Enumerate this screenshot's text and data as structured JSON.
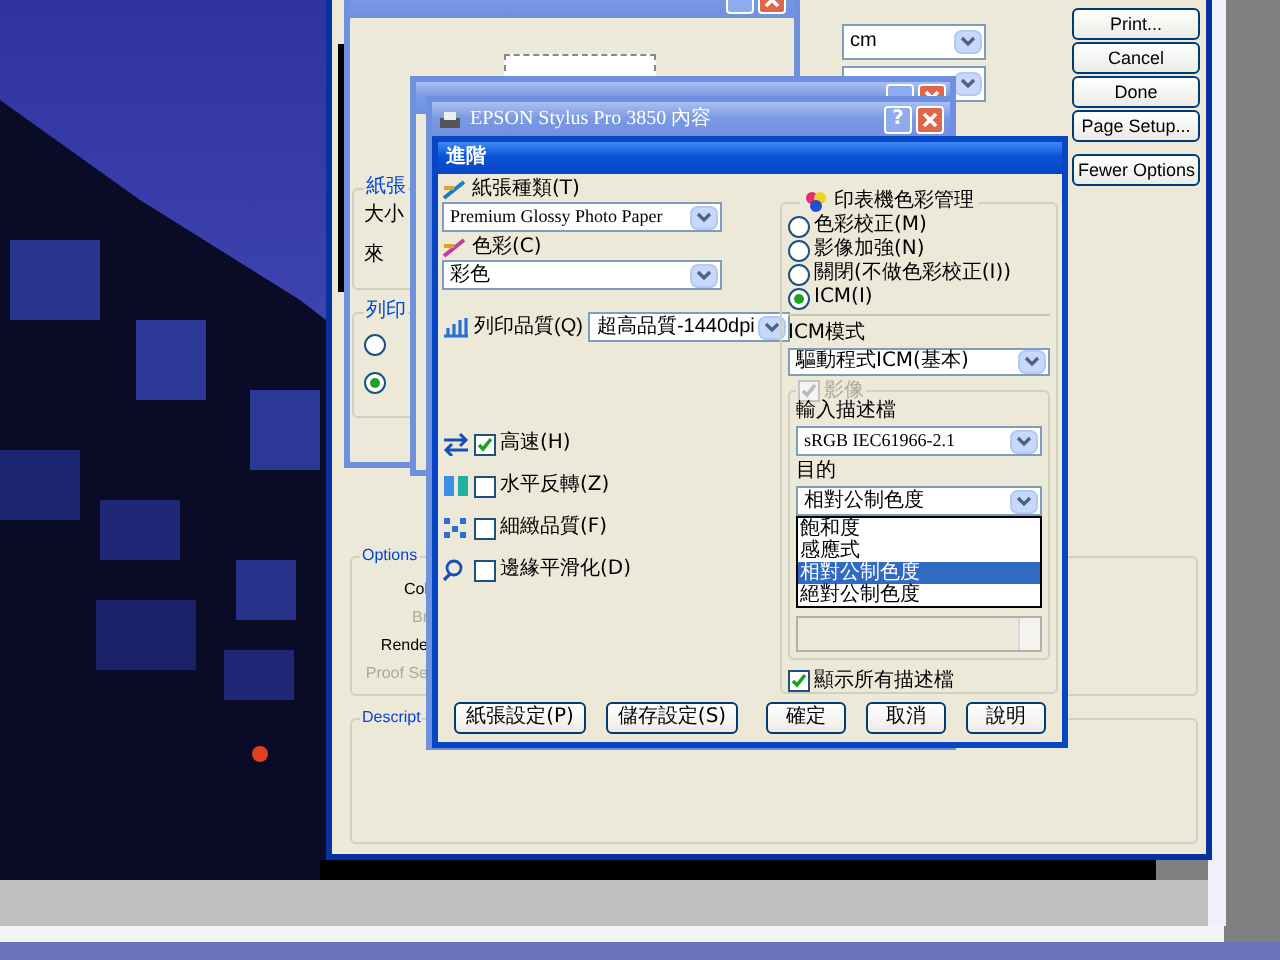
{
  "print_dialog": {
    "unit_dropdown": "cm",
    "buttons": [
      {
        "label": "Print..."
      },
      {
        "label": "Cancel"
      },
      {
        "label": "Done"
      },
      {
        "label": "Page Setup..."
      },
      {
        "label": "Fewer Options"
      }
    ],
    "options_group": {
      "title": "Options",
      "labels": [
        {
          "text": "Col",
          "disabled": false
        },
        {
          "text": "Br",
          "disabled": true
        },
        {
          "text": "Rende",
          "disabled": false
        },
        {
          "text": "Proof Se",
          "disabled": true
        }
      ]
    },
    "description_group": {
      "title": "Descript"
    }
  },
  "page_setup": {
    "paper_group": {
      "title": "紙張",
      "labels": [
        "大小",
        "來"
      ]
    },
    "orientation_group": {
      "title": "列印",
      "options": [
        {
          "selected": false
        },
        {
          "selected": true
        }
      ]
    }
  },
  "epson_window": {
    "title": "EPSON Stylus Pro 3850 內容",
    "help_button": "?"
  },
  "advanced": {
    "title": "進階",
    "paper_type": {
      "label": "紙張種類(T)",
      "value": "Premium Glossy Photo Paper"
    },
    "color": {
      "label": "色彩(C)",
      "value": "彩色"
    },
    "quality": {
      "label": "列印品質(Q)",
      "value": "超高品質-1440dpi"
    },
    "options": [
      {
        "label": "高速(H)",
        "checked": true
      },
      {
        "label": "水平反轉(Z)",
        "checked": false
      },
      {
        "label": "細緻品質(F)",
        "checked": false
      },
      {
        "label": "邊緣平滑化(D)",
        "checked": false
      }
    ],
    "color_management": {
      "title": "印表機色彩管理",
      "modes": [
        {
          "label": "色彩校正(M)",
          "selected": false
        },
        {
          "label": "影像加強(N)",
          "selected": false
        },
        {
          "label": "關閉(不做色彩校正(I))",
          "selected": false
        },
        {
          "label": "ICM(I)",
          "selected": true
        }
      ],
      "icm_label": "ICM模式",
      "icm_value": "驅動程式ICM(基本)",
      "image_checkbox": {
        "label": "影像",
        "checked": true,
        "disabled": true
      },
      "input_profile_label": "輸入描述檔",
      "input_profile": "sRGB IEC61966-2.1",
      "intent_label": "目的",
      "intent_value": "相對公制色度",
      "intent_options": [
        {
          "label": "飽和度",
          "selected": false
        },
        {
          "label": "感應式",
          "selected": false
        },
        {
          "label": "相對公制色度",
          "selected": true
        },
        {
          "label": "絕對公制色度",
          "selected": false
        }
      ],
      "show_all": {
        "label": "顯示所有描述檔",
        "checked": true
      }
    },
    "left_buttons": [
      {
        "label": "紙張設定(P)"
      },
      {
        "label": "儲存設定(S)"
      }
    ],
    "right_buttons": [
      {
        "label": "確定"
      },
      {
        "label": "取消"
      },
      {
        "label": "說明"
      }
    ]
  }
}
